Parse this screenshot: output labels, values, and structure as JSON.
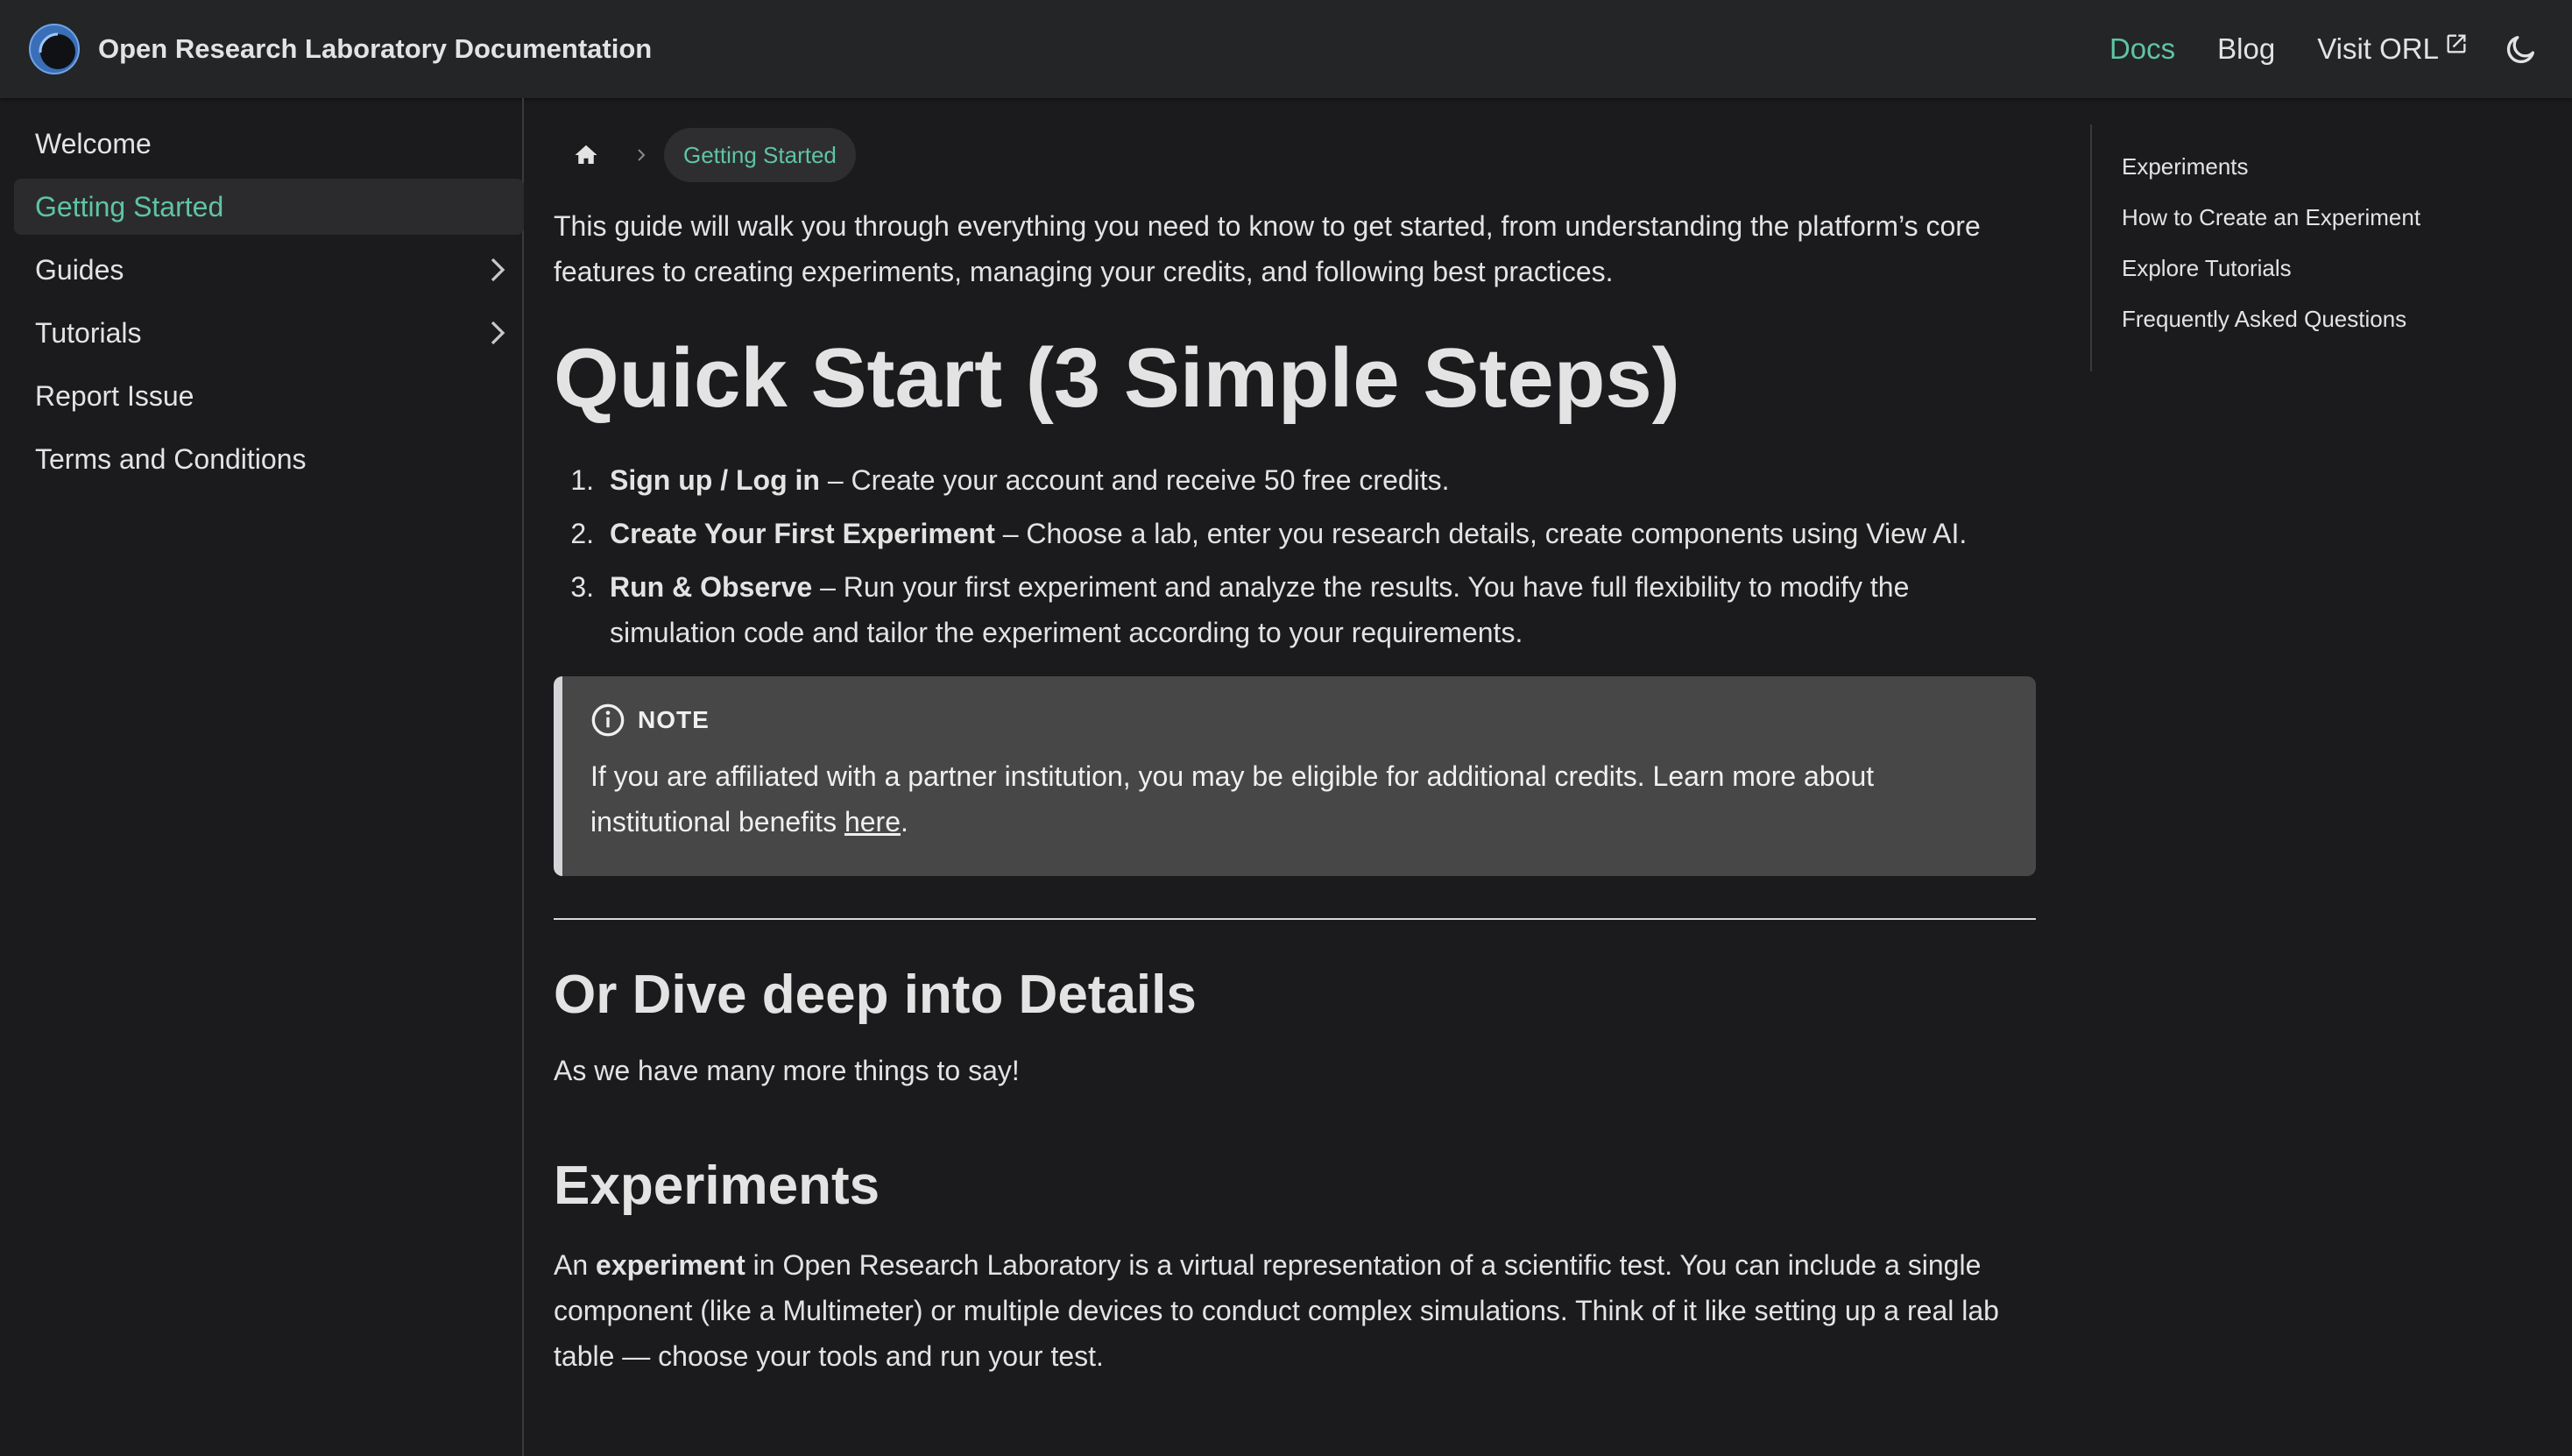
{
  "navbar": {
    "title": "Open Research Laboratory Documentation",
    "links": {
      "docs": "Docs",
      "blog": "Blog",
      "visit": "Visit ORL"
    },
    "accent_color": "#5fc4a4",
    "theme_icon": "moon-icon"
  },
  "sidebar": {
    "items": [
      {
        "label": "Welcome"
      },
      {
        "label": "Getting Started",
        "active": true
      },
      {
        "label": "Guides",
        "expandable": true
      },
      {
        "label": "Tutorials",
        "expandable": true
      },
      {
        "label": "Report Issue"
      },
      {
        "label": "Terms and Conditions"
      }
    ]
  },
  "breadcrumb": {
    "home_icon": "home-icon",
    "current": "Getting Started"
  },
  "content": {
    "intro": "This guide will walk you through everything you need to know to get started, from understanding the platform’s core features to creating experiments, managing your credits, and following best practices.",
    "h1": "Quick Start (3 Simple Steps)",
    "steps": [
      {
        "num": "1.",
        "bold": "Sign up / Log in",
        "text": " – Create your account and receive 50 free credits."
      },
      {
        "num": "2.",
        "bold": "Create Your First Experiment",
        "text": " – Choose a lab, enter you research details, create components using View AI."
      },
      {
        "num": "3.",
        "bold": "Run & Observe",
        "text": " – Run your first experiment and analyze the results. You have full flexibility to modify the simulation code and tailor the experiment according to your requirements."
      }
    ],
    "note": {
      "title": "NOTE",
      "body": "If you are affiliated with a partner institution, you may be eligible for additional credits. Learn more about institutional benefits ",
      "link": "here",
      "after": "."
    },
    "h2_details": "Or Dive deep into Details",
    "details_text": "As we have many more things to say!",
    "h2_experiments": "Experiments",
    "experiments_pre": "An ",
    "experiments_bold": "experiment",
    "experiments_text": " in Open Research Laboratory is a virtual representation of a scientific test. You can include a single component (like a Multimeter) or multiple devices to conduct complex simulations. Think of it like setting up a real lab table — choose your tools and run your test."
  },
  "toc": {
    "items": [
      "Experiments",
      "How to Create an Experiment",
      "Explore Tutorials",
      "Frequently Asked Questions"
    ]
  }
}
